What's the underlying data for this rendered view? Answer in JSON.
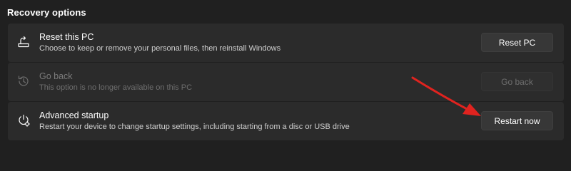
{
  "section": {
    "title": "Recovery options"
  },
  "options": [
    {
      "icon": "reset-pc-icon",
      "title": "Reset this PC",
      "description": "Choose to keep or remove your personal files, then reinstall Windows",
      "button_label": "Reset PC",
      "enabled": true
    },
    {
      "icon": "history-icon",
      "title": "Go back",
      "description": "This option is no longer available on this PC",
      "button_label": "Go back",
      "enabled": false
    },
    {
      "icon": "advanced-startup-icon",
      "title": "Advanced startup",
      "description": "Restart your device to change startup settings, including starting from a disc or USB drive",
      "button_label": "Restart now",
      "enabled": true
    }
  ],
  "colors": {
    "background": "#202020",
    "card": "#2b2b2b",
    "button": "#373737",
    "annotation_arrow": "#e0231f"
  }
}
